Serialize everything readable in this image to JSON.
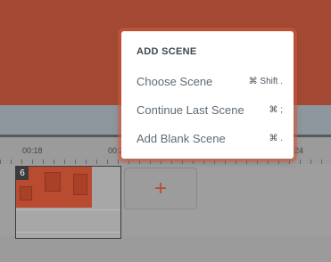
{
  "menu": {
    "header": "ADD SCENE",
    "items": [
      {
        "label": "Choose Scene",
        "shortcut": "⌘ Shift ."
      },
      {
        "label": "Continue Last Scene",
        "shortcut": "⌘ ;"
      },
      {
        "label": "Add Blank Scene",
        "shortcut": "⌘ ."
      }
    ]
  },
  "timeline": {
    "ticks": [
      "00:18",
      "00:2",
      "24"
    ]
  },
  "scene": {
    "number": "6"
  },
  "add_clip": {
    "icon": "plus-icon",
    "glyph": "+"
  },
  "colors": {
    "accent": "#b84b30",
    "canvas": "#a44a34"
  }
}
